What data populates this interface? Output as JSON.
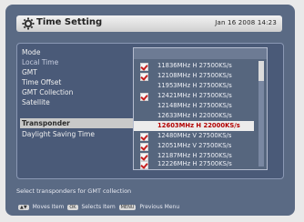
{
  "header": {
    "title": "Time Setting",
    "date": "Jan 16 2008 14:23"
  },
  "menu": {
    "items": [
      {
        "label": "Mode"
      },
      {
        "label": "Local Time"
      },
      {
        "label": "GMT"
      },
      {
        "label": "Time Offset"
      },
      {
        "label": "GMT Collection"
      },
      {
        "label": "Satellite"
      },
      {
        "label": "Transponder"
      },
      {
        "label": "Daylight Saving Time"
      }
    ],
    "highlighted_index": 6
  },
  "transponder_list": {
    "rows": [
      {
        "text": "11836MHz  H  27500KS/s",
        "checked": true
      },
      {
        "text": "12108MHz  H  27500KS/s",
        "checked": true
      },
      {
        "text": "11953MHz  H  27500KS/s",
        "checked": false
      },
      {
        "text": "12421MHz  H  27500KS/s",
        "checked": true
      },
      {
        "text": "12148MHz  H  27500KS/s",
        "checked": false
      },
      {
        "text": "12633MHz  H  22000KS/s",
        "checked": false
      },
      {
        "text": "12603MHz  H  22000KS/s",
        "checked": false,
        "selected": true
      },
      {
        "text": "12480MHz  V  27500KS/s",
        "checked": true
      },
      {
        "text": "12051MHz  V  27500KS/s",
        "checked": true
      },
      {
        "text": "12187MHz  H  27500KS/s",
        "checked": true
      },
      {
        "text": "12226MHz  H  27500KS/s",
        "checked": true
      }
    ]
  },
  "help_text": "Select transponders for GMT collection",
  "hints": {
    "move": "Moves Item",
    "select": "Selects Item",
    "previous": "Previous Menu",
    "move_key": "▲▼",
    "select_key": "OK",
    "previous_key": "MENU"
  },
  "colors": {
    "background": "#5a6a84",
    "selected_text": "#b30000",
    "check": "#c62020"
  }
}
